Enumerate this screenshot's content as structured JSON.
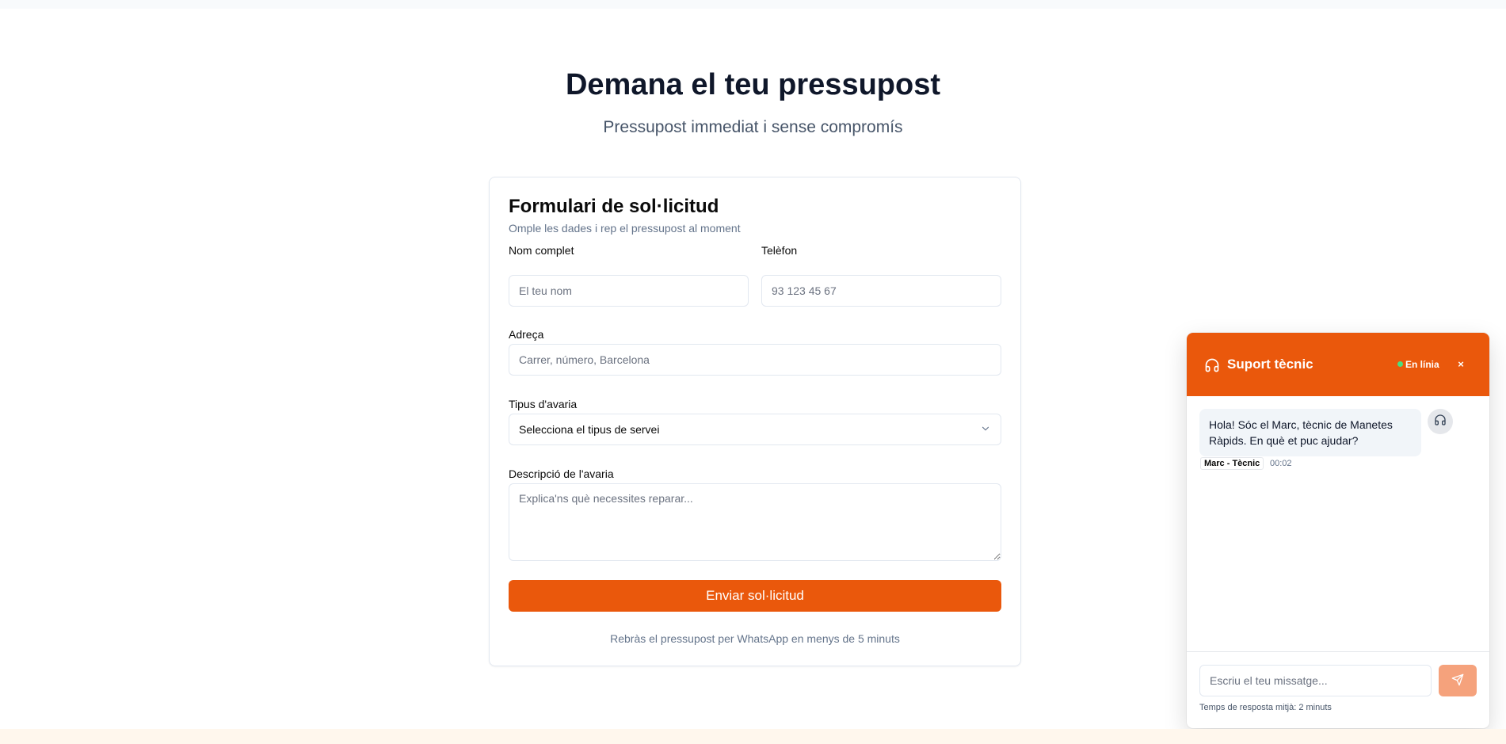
{
  "hero": {
    "title": "Demana el teu pressupost",
    "subtitle": "Pressupost immediat i sense compromís"
  },
  "form": {
    "title": "Formulari de sol·licitud",
    "subtitle": "Omple les dades i rep el pressupost al moment",
    "name": {
      "label": "Nom complet",
      "placeholder": "El teu nom"
    },
    "phone": {
      "label": "Telèfon",
      "placeholder": "93 123 45 67"
    },
    "address": {
      "label": "Adreça",
      "placeholder": "Carrer, número, Barcelona"
    },
    "fault_type": {
      "label": "Tipus d'avaria",
      "selected": "Selecciona el tipus de servei"
    },
    "description": {
      "label": "Descripció de l'avaria",
      "placeholder": "Explica'ns què necessites reparar..."
    },
    "submit_label": "Enviar sol·licitud",
    "note": "Rebràs el pressupost per WhatsApp en menys de 5 minuts"
  },
  "chat": {
    "title": "Suport tècnic",
    "status": "En línia",
    "close_label": "×",
    "messages": [
      {
        "text": "Hola! Sóc el Marc, tècnic de Manetes Ràpids. En què et puc ajudar?",
        "author": "Marc - Tècnic",
        "time": "00:02"
      }
    ],
    "input_placeholder": "Escriu el teu missatge...",
    "footnote": "Temps de resposta mitjà: 2 minuts"
  },
  "colors": {
    "accent": "#ea580c",
    "status_online": "#4ade80",
    "send_button_disabled": "#f5a27c"
  },
  "icons": {
    "chat_header": "headset-icon",
    "agent_avatar": "headset-icon",
    "select": "chevron-down-icon",
    "send": "send-icon"
  }
}
